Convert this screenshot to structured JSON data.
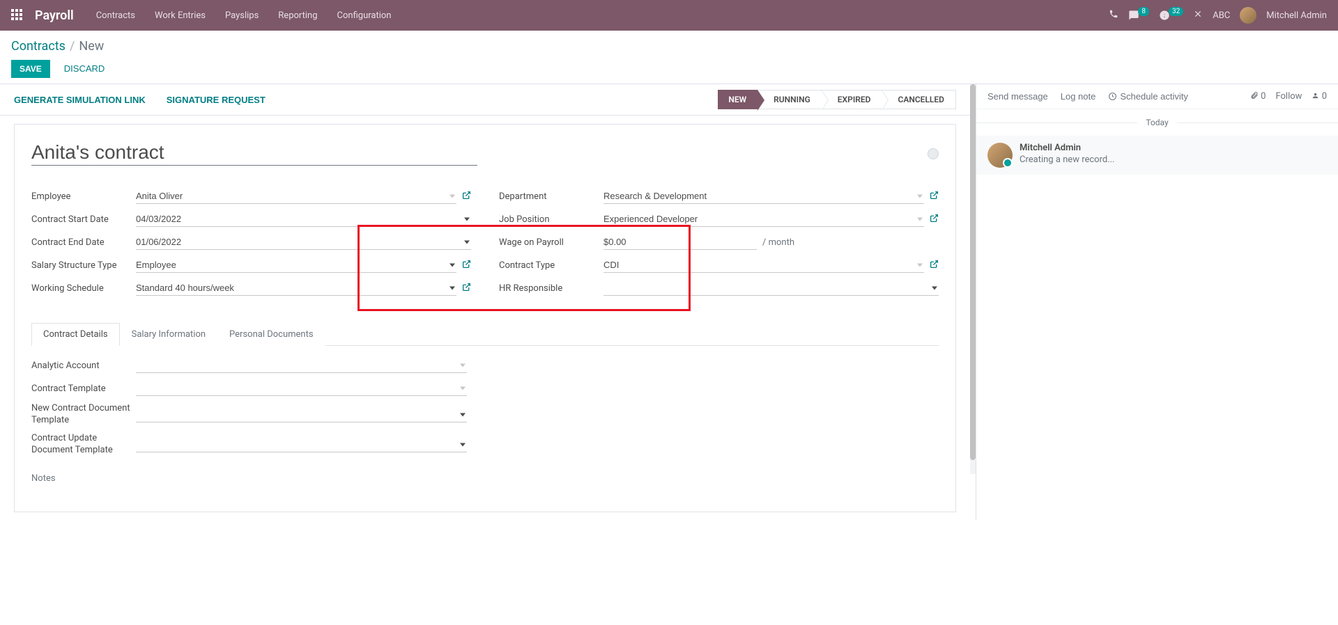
{
  "topbar": {
    "brand": "Payroll",
    "nav": [
      "Contracts",
      "Work Entries",
      "Payslips",
      "Reporting",
      "Configuration"
    ],
    "messages_count": "8",
    "activities_count": "32",
    "company": "ABC",
    "user": "Mitchell Admin"
  },
  "breadcrumb": {
    "back": "Contracts",
    "current": "New"
  },
  "actions": {
    "save": "SAVE",
    "discard": "DISCARD"
  },
  "header_buttons": {
    "simlink": "GENERATE SIMULATION LINK",
    "sigreq": "SIGNATURE REQUEST"
  },
  "status_steps": [
    {
      "label": "NEW",
      "active": true
    },
    {
      "label": "RUNNING",
      "active": false
    },
    {
      "label": "EXPIRED",
      "active": false
    },
    {
      "label": "CANCELLED",
      "active": false
    }
  ],
  "form": {
    "title": "Anita's contract",
    "left": {
      "employee": {
        "label": "Employee",
        "value": "Anita Oliver"
      },
      "start_date": {
        "label": "Contract Start Date",
        "value": "04/03/2022"
      },
      "end_date": {
        "label": "Contract End Date",
        "value": "01/06/2022"
      },
      "salary_structure": {
        "label": "Salary Structure Type",
        "value": "Employee"
      },
      "working_schedule": {
        "label": "Working Schedule",
        "value": "Standard 40 hours/week"
      }
    },
    "right": {
      "department": {
        "label": "Department",
        "value": "Research & Development"
      },
      "job_position": {
        "label": "Job Position",
        "value": "Experienced Developer"
      },
      "wage": {
        "label": "Wage on Payroll",
        "value": "$0.00",
        "unit": "/ month"
      },
      "contract_type": {
        "label": "Contract Type",
        "value": "CDI"
      },
      "hr_responsible": {
        "label": "HR Responsible",
        "value": ""
      }
    }
  },
  "tabs": [
    "Contract Details",
    "Salary Information",
    "Personal Documents"
  ],
  "details": {
    "analytic": {
      "label": "Analytic Account",
      "value": ""
    },
    "template": {
      "label": "Contract Template",
      "value": ""
    },
    "new_doc": {
      "label": "New Contract Document Template",
      "value": ""
    },
    "update_doc": {
      "label": "Contract Update Document Template",
      "value": ""
    },
    "notes_label": "Notes"
  },
  "chatter": {
    "send": "Send message",
    "log": "Log note",
    "schedule": "Schedule activity",
    "attach_count": "0",
    "follow": "Follow",
    "follower_count": "0",
    "date_sep": "Today",
    "message": {
      "author": "Mitchell Admin",
      "body": "Creating a new record..."
    }
  }
}
